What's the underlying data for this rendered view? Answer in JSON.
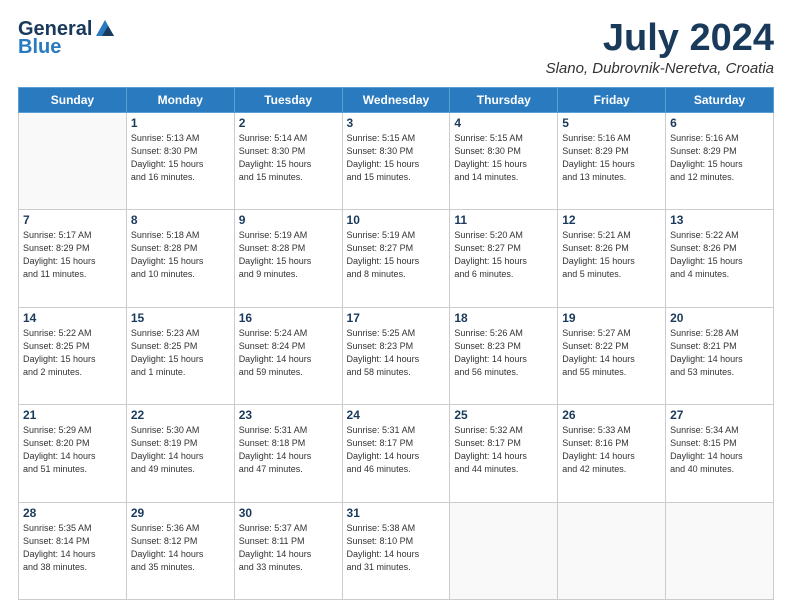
{
  "header": {
    "logo_general": "General",
    "logo_blue": "Blue",
    "month_title": "July 2024",
    "location": "Slano, Dubrovnik-Neretva, Croatia"
  },
  "weekdays": [
    "Sunday",
    "Monday",
    "Tuesday",
    "Wednesday",
    "Thursday",
    "Friday",
    "Saturday"
  ],
  "weeks": [
    [
      {
        "day": "",
        "info": ""
      },
      {
        "day": "1",
        "info": "Sunrise: 5:13 AM\nSunset: 8:30 PM\nDaylight: 15 hours\nand 16 minutes."
      },
      {
        "day": "2",
        "info": "Sunrise: 5:14 AM\nSunset: 8:30 PM\nDaylight: 15 hours\nand 15 minutes."
      },
      {
        "day": "3",
        "info": "Sunrise: 5:15 AM\nSunset: 8:30 PM\nDaylight: 15 hours\nand 15 minutes."
      },
      {
        "day": "4",
        "info": "Sunrise: 5:15 AM\nSunset: 8:30 PM\nDaylight: 15 hours\nand 14 minutes."
      },
      {
        "day": "5",
        "info": "Sunrise: 5:16 AM\nSunset: 8:29 PM\nDaylight: 15 hours\nand 13 minutes."
      },
      {
        "day": "6",
        "info": "Sunrise: 5:16 AM\nSunset: 8:29 PM\nDaylight: 15 hours\nand 12 minutes."
      }
    ],
    [
      {
        "day": "7",
        "info": "Sunrise: 5:17 AM\nSunset: 8:29 PM\nDaylight: 15 hours\nand 11 minutes."
      },
      {
        "day": "8",
        "info": "Sunrise: 5:18 AM\nSunset: 8:28 PM\nDaylight: 15 hours\nand 10 minutes."
      },
      {
        "day": "9",
        "info": "Sunrise: 5:19 AM\nSunset: 8:28 PM\nDaylight: 15 hours\nand 9 minutes."
      },
      {
        "day": "10",
        "info": "Sunrise: 5:19 AM\nSunset: 8:27 PM\nDaylight: 15 hours\nand 8 minutes."
      },
      {
        "day": "11",
        "info": "Sunrise: 5:20 AM\nSunset: 8:27 PM\nDaylight: 15 hours\nand 6 minutes."
      },
      {
        "day": "12",
        "info": "Sunrise: 5:21 AM\nSunset: 8:26 PM\nDaylight: 15 hours\nand 5 minutes."
      },
      {
        "day": "13",
        "info": "Sunrise: 5:22 AM\nSunset: 8:26 PM\nDaylight: 15 hours\nand 4 minutes."
      }
    ],
    [
      {
        "day": "14",
        "info": "Sunrise: 5:22 AM\nSunset: 8:25 PM\nDaylight: 15 hours\nand 2 minutes."
      },
      {
        "day": "15",
        "info": "Sunrise: 5:23 AM\nSunset: 8:25 PM\nDaylight: 15 hours\nand 1 minute."
      },
      {
        "day": "16",
        "info": "Sunrise: 5:24 AM\nSunset: 8:24 PM\nDaylight: 14 hours\nand 59 minutes."
      },
      {
        "day": "17",
        "info": "Sunrise: 5:25 AM\nSunset: 8:23 PM\nDaylight: 14 hours\nand 58 minutes."
      },
      {
        "day": "18",
        "info": "Sunrise: 5:26 AM\nSunset: 8:23 PM\nDaylight: 14 hours\nand 56 minutes."
      },
      {
        "day": "19",
        "info": "Sunrise: 5:27 AM\nSunset: 8:22 PM\nDaylight: 14 hours\nand 55 minutes."
      },
      {
        "day": "20",
        "info": "Sunrise: 5:28 AM\nSunset: 8:21 PM\nDaylight: 14 hours\nand 53 minutes."
      }
    ],
    [
      {
        "day": "21",
        "info": "Sunrise: 5:29 AM\nSunset: 8:20 PM\nDaylight: 14 hours\nand 51 minutes."
      },
      {
        "day": "22",
        "info": "Sunrise: 5:30 AM\nSunset: 8:19 PM\nDaylight: 14 hours\nand 49 minutes."
      },
      {
        "day": "23",
        "info": "Sunrise: 5:31 AM\nSunset: 8:18 PM\nDaylight: 14 hours\nand 47 minutes."
      },
      {
        "day": "24",
        "info": "Sunrise: 5:31 AM\nSunset: 8:17 PM\nDaylight: 14 hours\nand 46 minutes."
      },
      {
        "day": "25",
        "info": "Sunrise: 5:32 AM\nSunset: 8:17 PM\nDaylight: 14 hours\nand 44 minutes."
      },
      {
        "day": "26",
        "info": "Sunrise: 5:33 AM\nSunset: 8:16 PM\nDaylight: 14 hours\nand 42 minutes."
      },
      {
        "day": "27",
        "info": "Sunrise: 5:34 AM\nSunset: 8:15 PM\nDaylight: 14 hours\nand 40 minutes."
      }
    ],
    [
      {
        "day": "28",
        "info": "Sunrise: 5:35 AM\nSunset: 8:14 PM\nDaylight: 14 hours\nand 38 minutes."
      },
      {
        "day": "29",
        "info": "Sunrise: 5:36 AM\nSunset: 8:12 PM\nDaylight: 14 hours\nand 35 minutes."
      },
      {
        "day": "30",
        "info": "Sunrise: 5:37 AM\nSunset: 8:11 PM\nDaylight: 14 hours\nand 33 minutes."
      },
      {
        "day": "31",
        "info": "Sunrise: 5:38 AM\nSunset: 8:10 PM\nDaylight: 14 hours\nand 31 minutes."
      },
      {
        "day": "",
        "info": ""
      },
      {
        "day": "",
        "info": ""
      },
      {
        "day": "",
        "info": ""
      }
    ]
  ]
}
